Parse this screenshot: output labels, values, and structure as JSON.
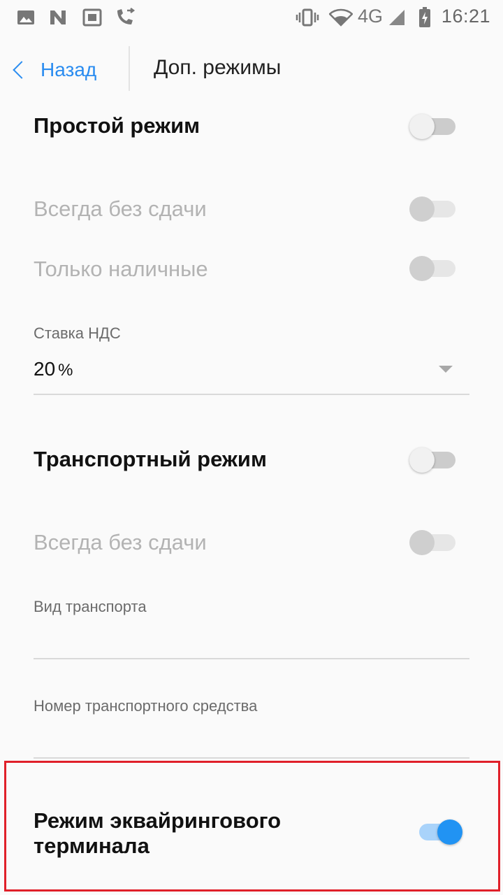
{
  "status_bar": {
    "time": "16:21",
    "network": "4G",
    "icons": [
      "image-icon",
      "n-app-icon",
      "screen-icon",
      "call-forward-icon",
      "vibrate-icon",
      "wifi-icon",
      "signal-icon",
      "battery-charging-icon"
    ]
  },
  "header": {
    "back_label": "Назад",
    "title": "Доп. режимы"
  },
  "simple_mode": {
    "label": "Простой режим",
    "enabled": false,
    "always_no_change": {
      "label": "Всегда без сдачи",
      "enabled": false,
      "disabled": true
    },
    "cash_only": {
      "label": "Только наличные",
      "enabled": false,
      "disabled": true
    },
    "vat_rate": {
      "label": "Ставка НДС",
      "value": "20",
      "unit": "%"
    }
  },
  "transport_mode": {
    "label": "Транспортный режим",
    "enabled": false,
    "always_no_change": {
      "label": "Всегда без сдачи",
      "enabled": false,
      "disabled": true
    },
    "transport_type": {
      "label": "Вид транспорта",
      "value": ""
    },
    "vehicle_number": {
      "label": "Номер транспортного средства",
      "value": ""
    }
  },
  "acquiring_mode": {
    "label_line1": "Режим эквайрингового",
    "label_line2": "терминала",
    "enabled": true
  },
  "colors": {
    "accent": "#2193f3",
    "highlight_border": "#e0202a"
  }
}
